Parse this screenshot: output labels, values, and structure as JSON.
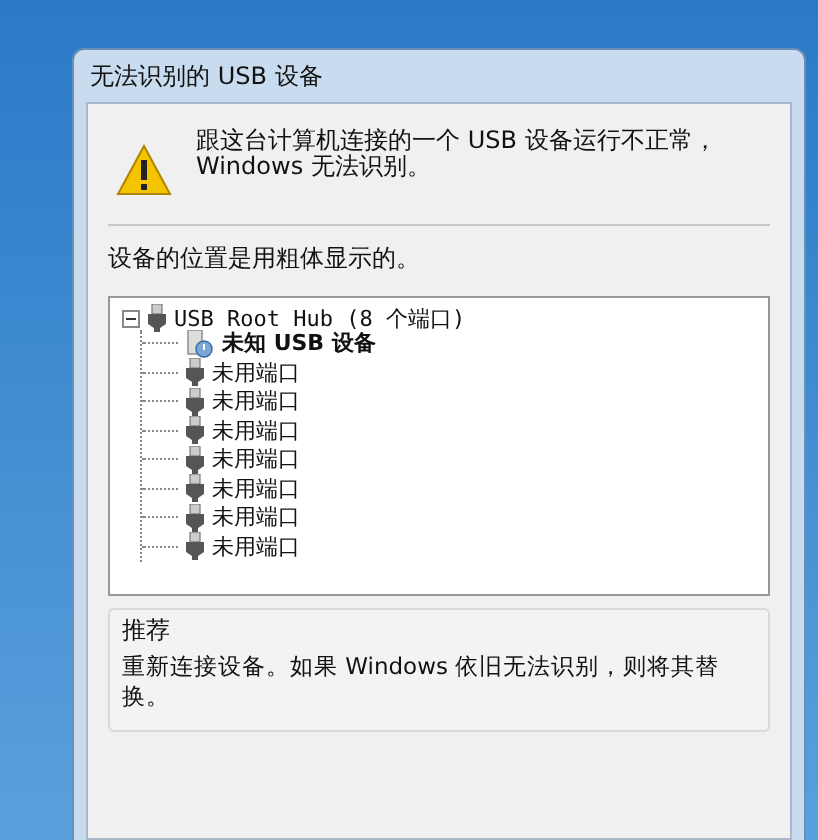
{
  "window": {
    "title": "无法识别的 USB 设备"
  },
  "message": "跟这台计算机连接的一个 USB 设备运行不正常，Windows 无法识别。",
  "tree_caption": "设备的位置是用粗体显示的。",
  "tree": {
    "label": "USB Root Hub (8 个端口)",
    "expanded": true,
    "children": [
      {
        "label": "未知 USB 设备",
        "kind": "unknown-device",
        "bold": true
      },
      {
        "label": "未用端口",
        "kind": "port",
        "bold": false
      },
      {
        "label": "未用端口",
        "kind": "port",
        "bold": false
      },
      {
        "label": "未用端口",
        "kind": "port",
        "bold": false
      },
      {
        "label": "未用端口",
        "kind": "port",
        "bold": false
      },
      {
        "label": "未用端口",
        "kind": "port",
        "bold": false
      },
      {
        "label": "未用端口",
        "kind": "port",
        "bold": false
      },
      {
        "label": "未用端口",
        "kind": "port",
        "bold": false
      }
    ]
  },
  "recommendation": {
    "heading": "推荐",
    "text": "重新连接设备。如果 Windows 依旧无法识别，则将其替换。"
  }
}
